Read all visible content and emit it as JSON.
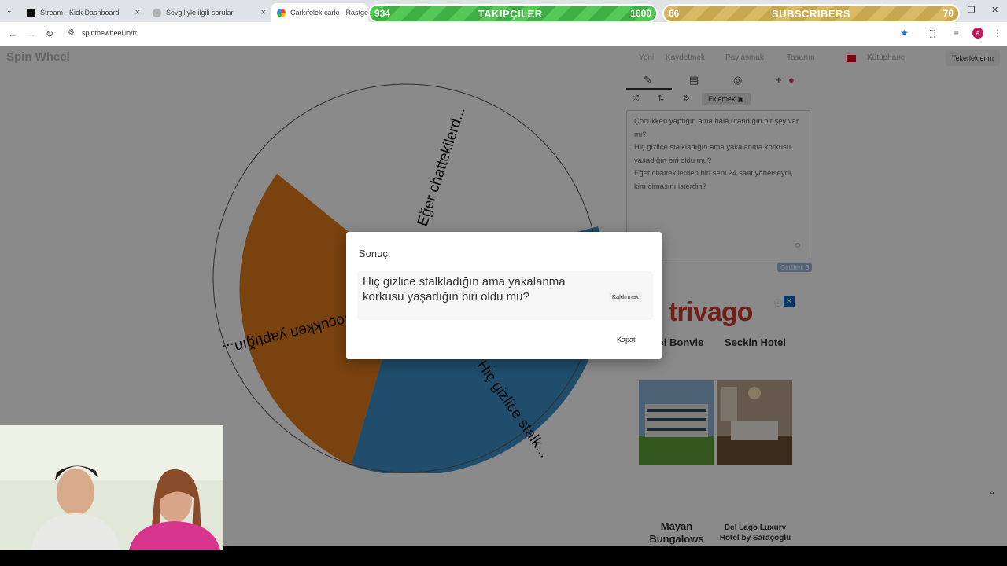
{
  "browser": {
    "tabs": [
      {
        "label": "Stream - Kick Dashboard",
        "favicon_color": "#53fc18"
      },
      {
        "label": "Sevgiliyle ilgili sorular",
        "favicon_color": "#9e9e9e"
      },
      {
        "label": "Çarkıfelek çarkı - Rastgele Se",
        "favicon_color": "#4285f4"
      }
    ],
    "url": "spinthewheel.io/tr"
  },
  "overlay": {
    "followers": {
      "current": "934",
      "label": "TAKIPÇILER",
      "goal": "1000",
      "progress": 0.934
    },
    "subscribers": {
      "current": "66",
      "label": "SUBSCRIBERS",
      "goal": "70",
      "progress": 0.943
    }
  },
  "site": {
    "logo": "Spin Wheel",
    "nav": [
      "Yeni",
      "Kaydetmek",
      "Paylaşmak",
      "Tasarım"
    ],
    "library": "Kütüphane",
    "my_wheels": "Tekerleklerim"
  },
  "editor": {
    "add_button": "Eklemek",
    "entries": [
      "Çocukken yaptığın ama hâlâ utandığın bir şey var mı?",
      "Hiç gizlice stalkladığın ama yakalanma korkusu yaşadığın biri oldu mu?",
      "Eğer chattekilerden biri seni 24 saat yönetseydi, kim olmasını isterdin?"
    ],
    "entries_count": "Girdileri: 3"
  },
  "wheel": {
    "slices": [
      {
        "label": "Eğer chattekilerd...",
        "color": "#ffffff"
      },
      {
        "label": "Hiç gizlice stalk...",
        "color": "#3a8fc6"
      },
      {
        "label": "Çocukken yaptığın...",
        "color": "#e07b1a"
      }
    ]
  },
  "ad": {
    "brand": "trivago",
    "hotels": [
      "...el Bonvie",
      "Seckin Hotel",
      "Mayan Bungalows",
      "Del Lago Luxury Hotel by Saraçoglu"
    ]
  },
  "modal": {
    "title": "Sonuç:",
    "result": "Hiç gizlice stalkladığın ama yakalanma korkusu yaşadığın biri oldu mu?",
    "remove_label": "Kaldırmak",
    "close_label": "Kapat"
  }
}
